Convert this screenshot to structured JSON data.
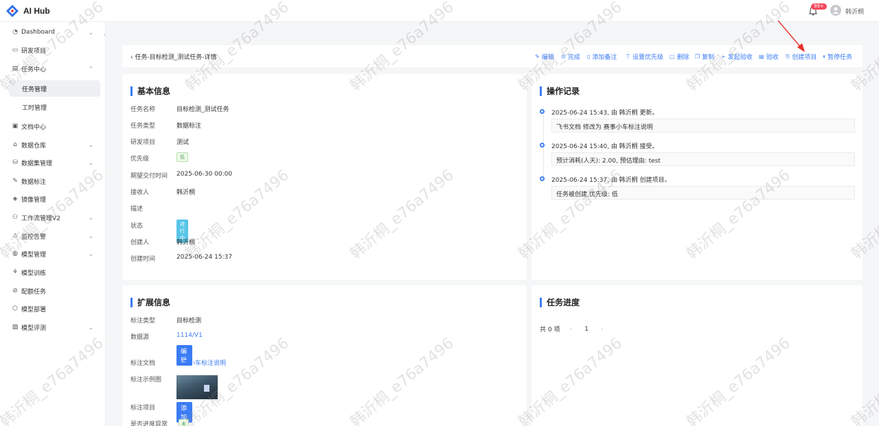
{
  "app": {
    "title": "AI Hub"
  },
  "topbar": {
    "badge": "99+",
    "username": "韩沂桐"
  },
  "sidebar": {
    "items": [
      {
        "label": "Dashboard",
        "icon": "dashboard-icon",
        "has_chevron": true
      },
      {
        "label": "研发项目",
        "icon": "folder-icon",
        "has_chevron": false
      },
      {
        "label": "任务中心",
        "icon": "task-icon",
        "has_chevron": true,
        "expanded": true
      },
      {
        "label": "任务管理",
        "sub": true,
        "active": true
      },
      {
        "label": "工时管理",
        "sub": true
      },
      {
        "label": "文档中心",
        "icon": "document-icon",
        "has_chevron": false
      },
      {
        "label": "数据仓库",
        "icon": "warehouse-icon",
        "has_chevron": true
      },
      {
        "label": "数据集管理",
        "icon": "database-icon",
        "has_chevron": true
      },
      {
        "label": "数据标注",
        "icon": "annotate-icon",
        "has_chevron": false
      },
      {
        "label": "镜像管理",
        "icon": "docker-icon",
        "has_chevron": false
      },
      {
        "label": "工作流管理V2",
        "icon": "workflow-icon",
        "has_chevron": true
      },
      {
        "label": "监控告警",
        "icon": "alert-icon",
        "has_chevron": true
      },
      {
        "label": "模型管理",
        "icon": "model-icon",
        "has_chevron": true
      },
      {
        "label": "模型训练",
        "icon": "train-icon",
        "has_chevron": false
      },
      {
        "label": "配额任务",
        "icon": "quota-icon",
        "has_chevron": false
      },
      {
        "label": "模型部署",
        "icon": "deploy-icon",
        "has_chevron": false
      },
      {
        "label": "模型评测",
        "icon": "evaluate-icon",
        "has_chevron": true
      }
    ]
  },
  "header": {
    "breadcrumb": "任务-目标检测_测试任务-详情",
    "actions": [
      {
        "label": "编辑",
        "icon": "edit-icon"
      },
      {
        "label": "完成",
        "icon": "check-circle-icon"
      },
      {
        "label": "添加备注",
        "icon": "note-icon"
      },
      {
        "label": "设置优先级",
        "icon": "priority-icon"
      },
      {
        "label": "删除",
        "icon": "delete-icon"
      },
      {
        "label": "复制",
        "icon": "copy-icon"
      },
      {
        "label": "发起验收",
        "icon": "send-icon"
      },
      {
        "label": "验收",
        "icon": "accept-icon"
      },
      {
        "label": "创建项目",
        "icon": "create-project-icon"
      },
      {
        "label": "暂停任务",
        "icon": "pause-icon"
      }
    ]
  },
  "basic_info": {
    "title": "基本信息",
    "rows": {
      "name": {
        "k": "任务名称",
        "v": "目标检测_测试任务"
      },
      "type": {
        "k": "任务类型",
        "v": "数据标注"
      },
      "project": {
        "k": "研发项目",
        "v": "测试"
      },
      "priority": {
        "k": "优先级",
        "v": "低"
      },
      "due": {
        "k": "期望交付时间",
        "v": "2025-06-30 00:00"
      },
      "assignee": {
        "k": "接收人",
        "v": "韩沂桐"
      },
      "desc": {
        "k": "描述",
        "v": ""
      },
      "status": {
        "k": "状态",
        "v": "进行中"
      },
      "creator": {
        "k": "创建人",
        "v": "韩沂桐"
      },
      "created": {
        "k": "创建时间",
        "v": "2025-06-24 15:37"
      }
    }
  },
  "ext_info": {
    "title": "扩展信息",
    "rows": {
      "label_type": {
        "k": "标注类型",
        "v": "目标检测"
      },
      "source": {
        "k": "数据源",
        "v": "1114/V1"
      },
      "edit_btn": "编 辑",
      "doc": {
        "k": "标注文档",
        "v": "赛事小车标注说明"
      },
      "example": {
        "k": "标注示例图"
      },
      "label_proj": {
        "k": "标注项目",
        "btn": "添 加"
      },
      "anomaly": {
        "k": "是否进度异常",
        "v": "未知"
      }
    }
  },
  "op_log": {
    "title": "操作记录",
    "entries": [
      {
        "text": "2025-06-24 15:43, 由 韩沂桐 更新。",
        "detail": "飞书文档 修改为 赛事小车标注说明"
      },
      {
        "text": "2025-06-24 15:40, 由 韩沂桐 接受。",
        "detail": "预计消耗(人天): 2.00, 预估理由: test"
      },
      {
        "text": "2025-06-24 15:37, 由 韩沂桐 创建项目。",
        "detail": "任务被创建,优先级: 低"
      }
    ]
  },
  "progress": {
    "title": "任务进度",
    "total": "共 0 项",
    "page": "1"
  },
  "watermark": "韩沂桐_e76a7496",
  "colors": {
    "accent": "#3b7cf5",
    "badge": "#f5485d",
    "arrow": "#e8302a"
  }
}
